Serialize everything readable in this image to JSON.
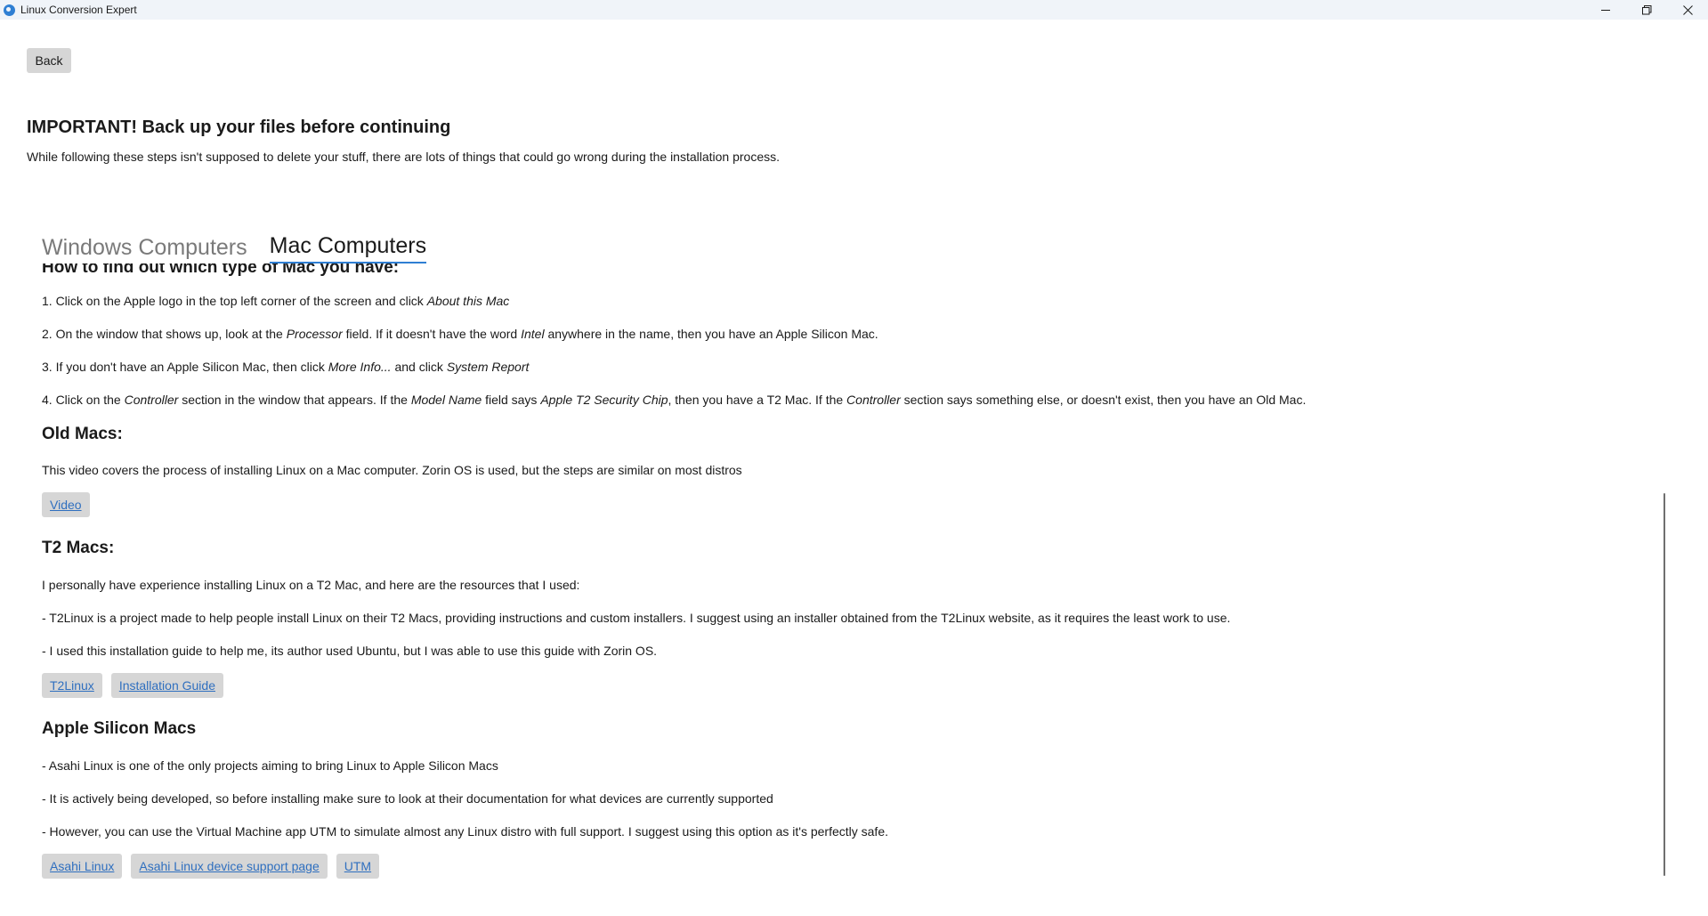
{
  "window": {
    "title": "Linux Conversion Expert"
  },
  "header": {
    "back_label": "Back",
    "warning_title": "IMPORTANT! Back up your files before continuing",
    "warning_text": "While following these steps isn't supposed to delete your stuff, there are lots of things that could go wrong during the installation process."
  },
  "tabs": [
    {
      "label": "Windows Computers",
      "active": false
    },
    {
      "label": "Mac Computers",
      "active": true
    }
  ],
  "mac": {
    "find_type_heading": "How to find out which type of Mac you have:",
    "step1": {
      "a": "1. Click on the Apple logo in the top left corner of the screen and click ",
      "b": "About this Mac"
    },
    "step2": {
      "a": "2. On the window that shows up, look at the ",
      "b": "Processor",
      "c": " field. If it doesn't have the word ",
      "d": "Intel",
      "e": " anywhere in the name, then you have an Apple Silicon Mac."
    },
    "step3": {
      "a": "3. If you don't have an Apple Silicon Mac, then click ",
      "b": "More Info...",
      "c": " and click ",
      "d": "System Report"
    },
    "step4": {
      "a": "4. Click on the ",
      "b": "Controller",
      "c": " section in the window that appears. If the ",
      "d": "Model Name",
      "e": " field says ",
      "f": "Apple T2 Security Chip",
      "g": ", then you have a T2 Mac. If the ",
      "h": "Controller",
      "i": " section says something else, or doesn't exist, then you have an Old Mac."
    },
    "old_heading": "Old Macs:",
    "old_text": "This video covers the process of installing Linux on a Mac computer. Zorin OS is used, but the steps are similar on most distros",
    "old_links": [
      "Video"
    ],
    "t2_heading": "T2 Macs:",
    "t2_text1": "I personally have experience installing Linux on a T2 Mac, and here are the resources that I used:",
    "t2_text2": "- T2Linux is a project made to help people install Linux on their T2 Macs, providing instructions and custom installers. I suggest using an installer obtained from the T2Linux website, as it requires the least work to use.",
    "t2_text3": "- I used this installation guide to help me, its author used Ubuntu, but I was able to use this guide with Zorin OS.",
    "t2_links": [
      "T2Linux",
      "Installation Guide"
    ],
    "as_heading": "Apple Silicon Macs",
    "as_text1": "- Asahi Linux is one of the only projects aiming to bring Linux to Apple Silicon Macs",
    "as_text2": "- It is actively being developed, so before installing make sure to look at their documentation for what devices are currently supported",
    "as_text3": "- However, you can use the Virtual Machine app UTM to simulate almost any Linux distro with full support. I suggest using this option as it's perfectly safe.",
    "as_links": [
      "Asahi Linux",
      "Asahi Linux device support page",
      "UTM"
    ]
  },
  "colors": {
    "accent": "#2f7fd3",
    "link": "#2f6fbf",
    "button_bg": "#d6d6d6",
    "titlebar_bg": "#f0f4f9"
  }
}
